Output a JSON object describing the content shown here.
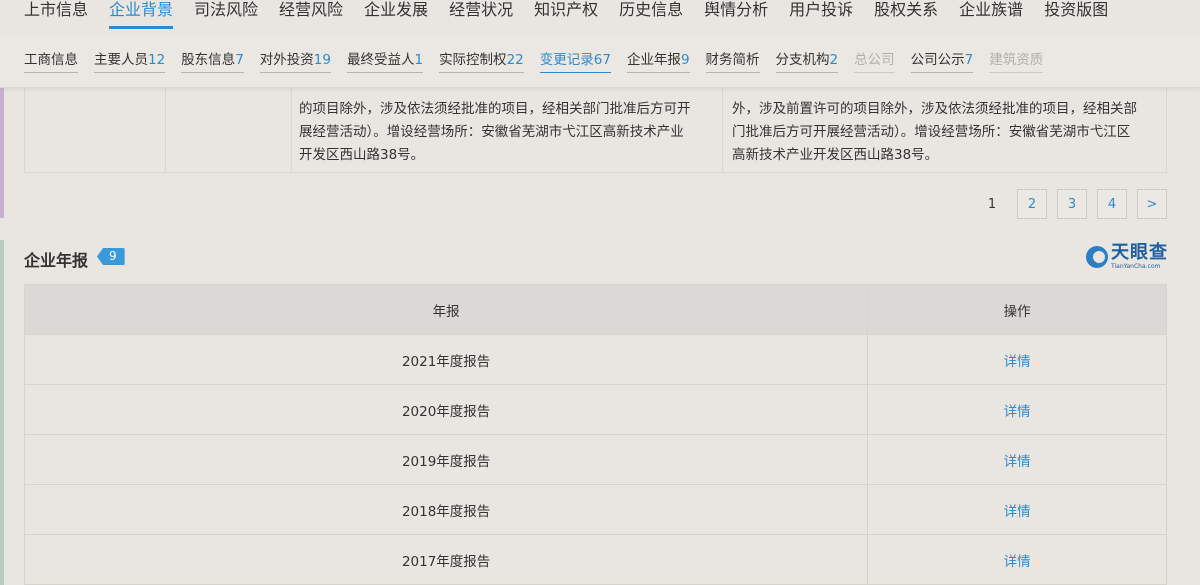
{
  "top_nav": {
    "items": [
      {
        "label": "上市信息",
        "active": false
      },
      {
        "label": "企业背景",
        "active": true
      },
      {
        "label": "司法风险",
        "active": false
      },
      {
        "label": "经营风险",
        "active": false
      },
      {
        "label": "企业发展",
        "active": false
      },
      {
        "label": "经营状况",
        "active": false
      },
      {
        "label": "知识产权",
        "active": false
      },
      {
        "label": "历史信息",
        "active": false
      },
      {
        "label": "舆情分析",
        "active": false
      },
      {
        "label": "用户投诉",
        "active": false
      },
      {
        "label": "股权关系",
        "active": false
      },
      {
        "label": "企业族谱",
        "active": false
      },
      {
        "label": "投资版图",
        "active": false
      }
    ]
  },
  "sub_nav": {
    "items": [
      {
        "label": "工商信息",
        "count": ""
      },
      {
        "label": "主要人员",
        "count": "12"
      },
      {
        "label": "股东信息",
        "count": "7"
      },
      {
        "label": "对外投资",
        "count": "19"
      },
      {
        "label": "最终受益人",
        "count": "1"
      },
      {
        "label": "实际控制权",
        "count": "22"
      },
      {
        "label": "变更记录",
        "count": "67"
      },
      {
        "label": "企业年报",
        "count": "9"
      },
      {
        "label": "财务简析",
        "count": ""
      },
      {
        "label": "分支机构",
        "count": "2"
      },
      {
        "label": "总公司",
        "count": ""
      },
      {
        "label": "公司公示",
        "count": "7"
      },
      {
        "label": "建筑资质",
        "count": ""
      }
    ]
  },
  "change_record": {
    "before_text": [
      "的项目除外，涉及依法须经批准的项目，经相关部门批准后方可开",
      "展经营活动）。增设经营场所：安徽省芜湖市弋江区高新技术产业",
      "开发区西山路38号。"
    ],
    "after_text": [
      "外，涉及前置许可的项目除外，涉及依法须经批准的项目，经相关部",
      "门批准后方可开展经营活动）。增设经营场所：安徽省芜湖市弋江区",
      "高新技术产业开发区西山路38号。"
    ]
  },
  "pagination": {
    "current": "1",
    "pages": [
      "2",
      "3",
      "4"
    ],
    "next": ">"
  },
  "annual_report": {
    "title": "企业年报",
    "count": "9",
    "logo_cn": "天眼查",
    "logo_en": "TianYanCha.com",
    "headers": {
      "year": "年报",
      "action": "操作"
    },
    "rows": [
      {
        "year": "2021年度报告",
        "action": "详情"
      },
      {
        "year": "2020年度报告",
        "action": "详情"
      },
      {
        "year": "2019年度报告",
        "action": "详情"
      },
      {
        "year": "2018年度报告",
        "action": "详情"
      },
      {
        "year": "2017年度报告",
        "action": "详情"
      }
    ]
  },
  "colors": {
    "accent_blue": "#2c8bcf",
    "background": "#e9e6e1",
    "badge": "#3a9ad9"
  }
}
